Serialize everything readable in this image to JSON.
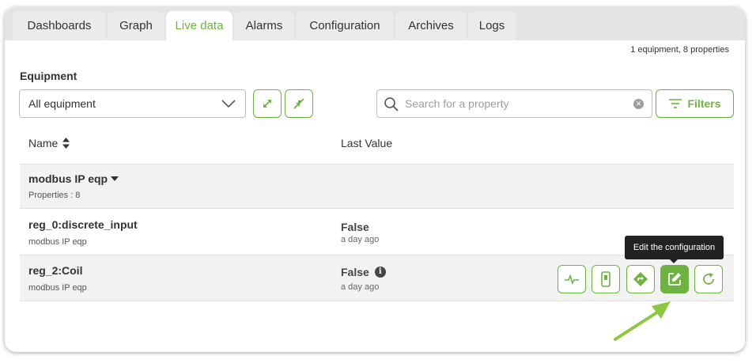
{
  "tabs": [
    {
      "label": "Dashboards",
      "active": false
    },
    {
      "label": "Graph",
      "active": false
    },
    {
      "label": "Live data",
      "active": true
    },
    {
      "label": "Alarms",
      "active": false
    },
    {
      "label": "Configuration",
      "active": false
    },
    {
      "label": "Archives",
      "active": false
    },
    {
      "label": "Logs",
      "active": false
    }
  ],
  "summary": "1 equipment, 8 properties",
  "equipment": {
    "label": "Equipment",
    "selected": "All equipment"
  },
  "search": {
    "placeholder": "Search for a property",
    "value": ""
  },
  "filters_label": "Filters",
  "columns": {
    "name": "Name",
    "last_value": "Last Value"
  },
  "group": {
    "name": "modbus IP eqp",
    "properties": "Properties : 8"
  },
  "rows": [
    {
      "name": "reg_0:discrete_input",
      "equipment": "modbus IP eqp",
      "value": "False",
      "time": "a day ago"
    },
    {
      "name": "reg_2:Coil",
      "equipment": "modbus IP eqp",
      "value": "False",
      "time": "a day ago"
    }
  ],
  "tooltip": "Edit the configuration",
  "icons": {
    "expand": "expand-icon",
    "collapse": "collapse-icon",
    "search": "search-icon",
    "clear": "clear-icon",
    "filter": "filter-icon",
    "sort": "sort-icon",
    "caret": "caret-down-icon",
    "info": "info-icon",
    "trend": "trend-icon",
    "device": "device-icon",
    "direction": "direction-icon",
    "edit": "edit-icon",
    "refresh": "refresh-icon"
  },
  "colors": {
    "accent": "#6cb33f",
    "tab_bar": "#e4e4e4",
    "row_alt": "#f2f2f2",
    "tooltip_bg": "#222222",
    "annotation_arrow": "#8dc63f"
  }
}
